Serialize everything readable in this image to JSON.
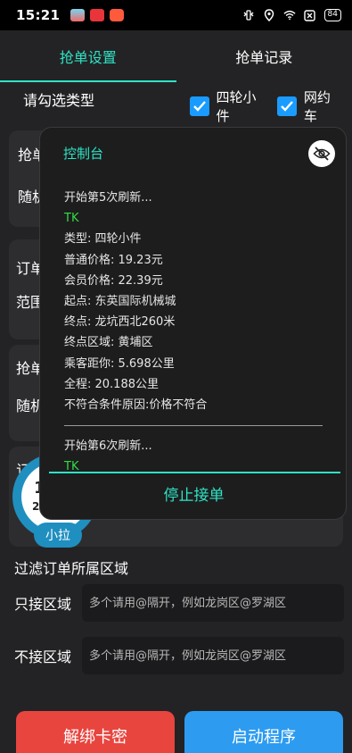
{
  "status_bar": {
    "time": "15:21",
    "battery": "84"
  },
  "tabs": [
    {
      "label": "抢单设置",
      "active": true
    },
    {
      "label": "抢单记录",
      "active": false
    }
  ],
  "type_select": {
    "label": "请勾选类型",
    "options": [
      {
        "label": "四轮小件",
        "checked": true
      },
      {
        "label": "网约车",
        "checked": true
      }
    ]
  },
  "background_labels": {
    "row1": "抢单",
    "row2": "随机",
    "row3": "订单",
    "row4": "范围",
    "row5": "抢单",
    "row6": "随机",
    "row7": "订"
  },
  "widget": {
    "number_top": "1",
    "number_bottom": "2",
    "badge": "小拉"
  },
  "console": {
    "title": "控制台",
    "lines": [
      {
        "text": "开始第5次刷新...",
        "color": "normal"
      },
      {
        "text": "TK",
        "color": "green"
      },
      {
        "text": "类型: 四轮小件",
        "color": "normal"
      },
      {
        "text": "普通价格:  19.23元",
        "color": "normal"
      },
      {
        "text": "会员价格:   22.39元",
        "color": "normal"
      },
      {
        "text": "起点: 东英国际机械城",
        "color": "normal"
      },
      {
        "text": "终点: 龙坑西北260米",
        "color": "normal"
      },
      {
        "text": "终点区域:  黄埔区",
        "color": "normal"
      },
      {
        "text": "乘客距你:  5.698公里",
        "color": "normal"
      },
      {
        "text": "全程: 20.188公里",
        "color": "normal"
      },
      {
        "text": "不符合条件原因:价格不符合",
        "color": "normal"
      },
      {
        "text": "",
        "color": "divider"
      },
      {
        "text": "开始第6次刷新...",
        "color": "normal"
      },
      {
        "text": "TK",
        "color": "green"
      }
    ],
    "stop_label": "停止接单"
  },
  "filter": {
    "title": "过滤订单所属区域",
    "include": {
      "label": "只接区域",
      "placeholder": "多个请用@隔开，例如龙岗区@罗湖区",
      "value": ""
    },
    "exclude": {
      "label": "不接区域",
      "placeholder": "多个请用@隔开，例如龙岗区@罗湖区",
      "value": ""
    }
  },
  "buttons": {
    "unbind": "解绑卡密",
    "start": "启动程序"
  },
  "colors": {
    "accent": "#2ee3c4",
    "log_green": "#33dd44",
    "red": "#e8453f",
    "blue": "#2d9bf0",
    "checkbox": "#1a9bff"
  }
}
